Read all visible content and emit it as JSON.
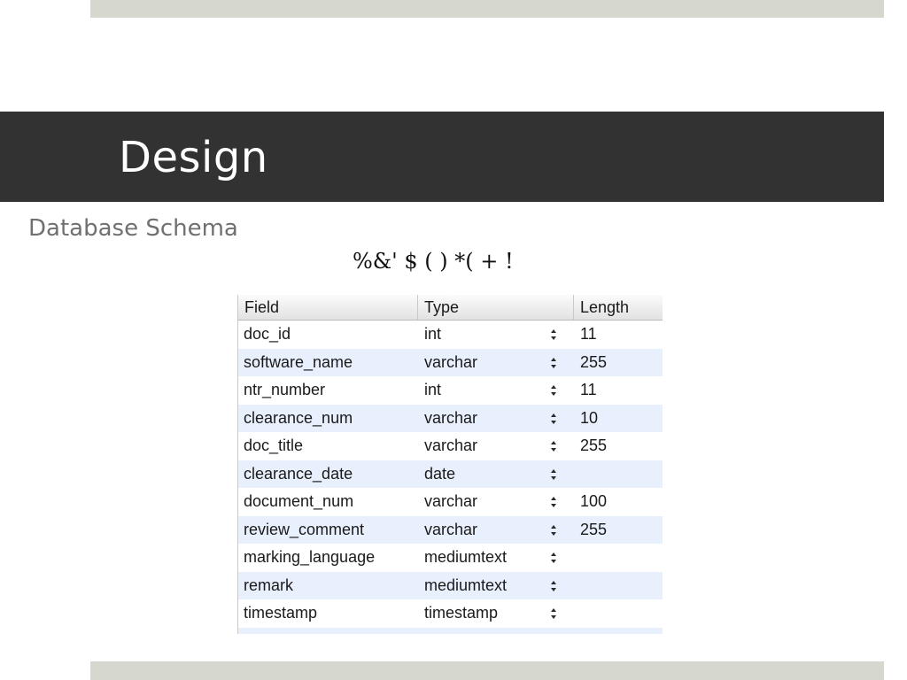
{
  "slide": {
    "title": "Design",
    "subtitle": "Database Schema",
    "garbled_text": "%&' $ ( ) *( + !"
  },
  "schema_table": {
    "columns": {
      "field": "Field",
      "type": "Type",
      "length": "Length"
    },
    "rows": [
      {
        "field": "doc_id",
        "type": "int",
        "length": "11"
      },
      {
        "field": "software_name",
        "type": "varchar",
        "length": "255"
      },
      {
        "field": "ntr_number",
        "type": "int",
        "length": "11"
      },
      {
        "field": "clearance_num",
        "type": "varchar",
        "length": "10"
      },
      {
        "field": "doc_title",
        "type": "varchar",
        "length": "255"
      },
      {
        "field": "clearance_date",
        "type": "date",
        "length": ""
      },
      {
        "field": "document_num",
        "type": "varchar",
        "length": "100"
      },
      {
        "field": "review_comment",
        "type": "varchar",
        "length": "255"
      },
      {
        "field": "marking_language",
        "type": "mediumtext",
        "length": ""
      },
      {
        "field": "remark",
        "type": "mediumtext",
        "length": ""
      },
      {
        "field": "timestamp",
        "type": "timestamp",
        "length": ""
      }
    ],
    "stepper_icon": "up-down-stepper-icon"
  },
  "colors": {
    "title_band": "#323232",
    "accent_bars": "#d6d8d0",
    "subtitle_text": "#707070",
    "row_stripe": "#e8f0fd"
  }
}
